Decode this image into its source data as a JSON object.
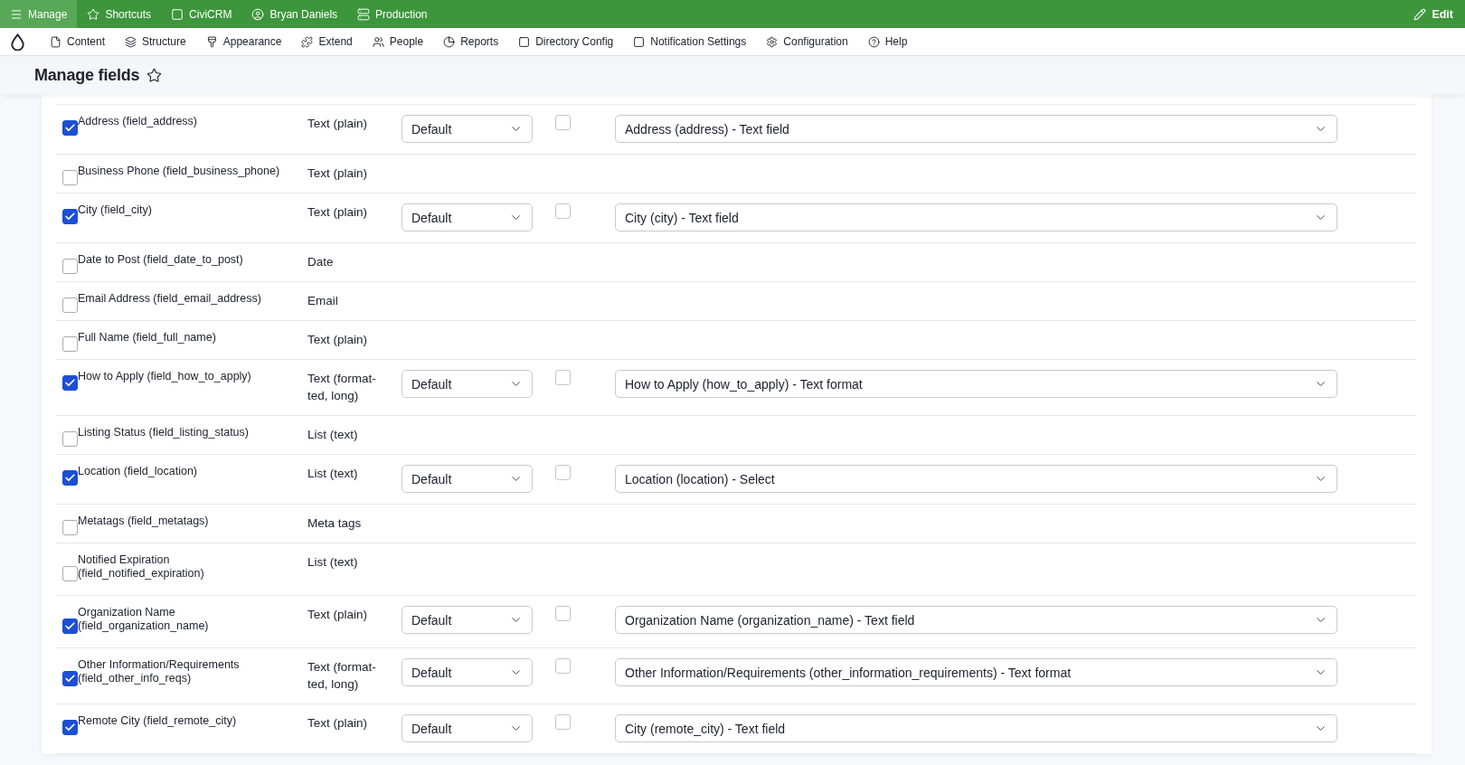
{
  "toolbar": {
    "items": [
      {
        "label": "Manage",
        "selected": true
      },
      {
        "label": "Shortcuts",
        "selected": false
      },
      {
        "label": "CiviCRM",
        "selected": false
      },
      {
        "label": "Bryan Daniels",
        "selected": false
      },
      {
        "label": "Production",
        "selected": false
      }
    ],
    "edit": "Edit"
  },
  "admin_menu": {
    "items": [
      "Content",
      "Structure",
      "Appearance",
      "Extend",
      "People",
      "Reports",
      "Directory Config",
      "Notification Settings",
      "Configuration",
      "Help"
    ]
  },
  "page_title": "Manage fields",
  "fields": [
    {
      "label": "Address (field_address)",
      "checked": true,
      "type": "Text (plain)",
      "column_3": "Default",
      "column_4_checked": false,
      "column_5": "Address (address) - Text field"
    },
    {
      "label": "Business Phone (field_business_phone)",
      "checked": false,
      "type": "Text (plain)"
    },
    {
      "label": "City (field_city)",
      "checked": true,
      "type": "Text (plain)",
      "column_3": "Default",
      "column_4_checked": false,
      "column_5": "City (city) - Text field"
    },
    {
      "label": "Date to Post (field_date_to_post)",
      "checked": false,
      "type": "Date"
    },
    {
      "label": "Email Address (field_email_address)",
      "checked": false,
      "type": "Email"
    },
    {
      "label": "Full Name (field_full_name)",
      "checked": false,
      "type": "Text (plain)"
    },
    {
      "label": "How to Apply (field_how_to_apply)",
      "checked": true,
      "type": "Text (format-ted, long)",
      "column_3": "Default",
      "column_4_checked": false,
      "column_5": "How to Apply (how_to_apply) - Text format"
    },
    {
      "label": "Listing Status (field_listing_status)",
      "checked": false,
      "type": "List (text)"
    },
    {
      "label": "Location (field_location)",
      "checked": true,
      "type": "List (text)",
      "column_3": "Default",
      "column_4_checked": false,
      "column_5": "Location (location) - Select"
    },
    {
      "label": "Metatags (field_metatags)",
      "checked": false,
      "type": "Meta tags"
    },
    {
      "label": "Notified Expiration (field_notified_expiration)",
      "checked": false,
      "type": "List (text)"
    },
    {
      "label": "Organization Name (field_organization_name)",
      "checked": true,
      "type": "Text (plain)",
      "column_3": "Default",
      "column_4_checked": false,
      "column_5": "Organization Name (organization_name) - Text field"
    },
    {
      "label": "Other Information/Requirements (field_other_info_reqs)",
      "checked": true,
      "type": "Text (format-ted, long)",
      "column_3": "Default",
      "column_4_checked": false,
      "column_5": "Other Information/Requirements (other_information_requirements) - Text format"
    },
    {
      "label": "Remote City (field_remote_city)",
      "checked": true,
      "type": "Text (plain)",
      "column_3": "Default",
      "column_4_checked": false,
      "column_5": "City (remote_city) - Text field"
    }
  ]
}
